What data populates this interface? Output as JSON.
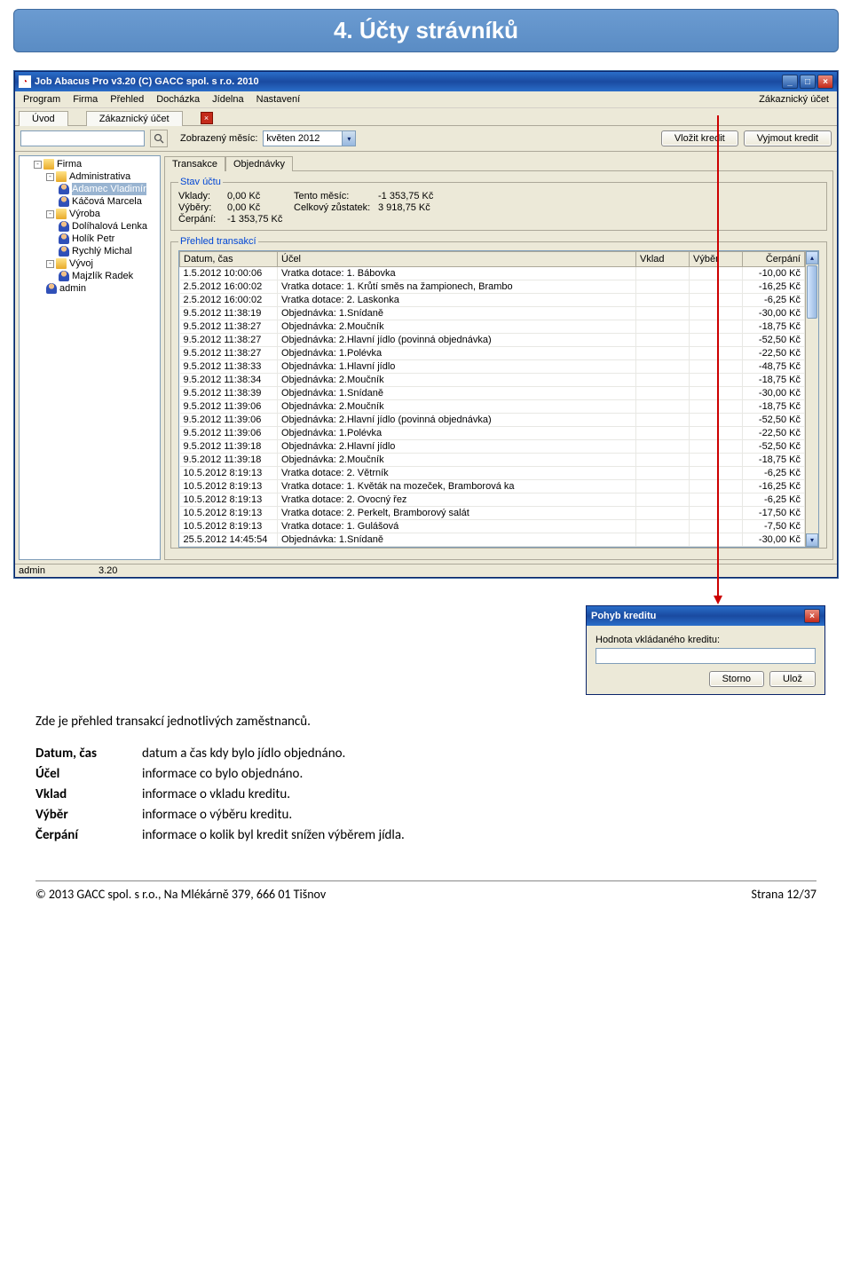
{
  "doc_title": "4. Účty strávníků",
  "window_title": "Job Abacus Pro v3.20 (C) GACC spol. s r.o. 2010",
  "menu": [
    "Program",
    "Firma",
    "Přehled",
    "Docházka",
    "Jídelna",
    "Nastavení"
  ],
  "menu_right": "Zákaznický účet",
  "tabs": {
    "intro": "Úvod",
    "account": "Zákaznický účet"
  },
  "toolbar": {
    "shown_month_label": "Zobrazený měsíc:",
    "shown_month_value": "květen 2012",
    "insert_credit": "Vložit kredit",
    "withdraw_credit": "Vyjmout kredit"
  },
  "tree": {
    "root": "Firma",
    "groups": [
      {
        "name": "Administrativa",
        "people": [
          "Adamec Vladimír",
          "Káčová Marcela"
        ]
      },
      {
        "name": "Výroba",
        "people": [
          "Dolíhalová Lenka",
          "Holík Petr",
          "Rychlý Michal"
        ]
      },
      {
        "name": "Vývoj",
        "people": [
          "Majzlík Radek"
        ]
      }
    ],
    "extra": "admin",
    "selected": "Adamec Vladimír"
  },
  "panel_tabs": {
    "trans": "Transakce",
    "orders": "Objednávky"
  },
  "account_state": {
    "legend": "Stav účtu",
    "rows": [
      [
        "Vklady:",
        "0,00 Kč",
        "Tento měsíc:",
        "-1 353,75 Kč"
      ],
      [
        "Výběry:",
        "0,00 Kč",
        "Celkový zůstatek:",
        "3 918,75 Kč"
      ],
      [
        "Čerpání:",
        "-1 353,75 Kč",
        "",
        ""
      ]
    ]
  },
  "trans_legend": "Přehled transakcí",
  "table": {
    "headers": [
      "Datum, čas",
      "Účel",
      "Vklad",
      "Výběr",
      "Čerpání"
    ],
    "rows": [
      [
        "1.5.2012 10:00:06",
        "Vratka dotace: 1. Bábovka",
        "",
        "",
        "-10,00 Kč"
      ],
      [
        "2.5.2012 16:00:02",
        "Vratka dotace: 1. Krůtí směs na žampionech, Brambo",
        "",
        "",
        "-16,25 Kč"
      ],
      [
        "2.5.2012 16:00:02",
        "Vratka dotace: 2. Laskonka",
        "",
        "",
        "-6,25 Kč"
      ],
      [
        "9.5.2012 11:38:19",
        "Objednávka: 1.Snídaně",
        "",
        "",
        "-30,00 Kč"
      ],
      [
        "9.5.2012 11:38:27",
        "Objednávka: 2.Moučník",
        "",
        "",
        "-18,75 Kč"
      ],
      [
        "9.5.2012 11:38:27",
        "Objednávka: 2.Hlavní jídlo (povinná objednávka)",
        "",
        "",
        "-52,50 Kč"
      ],
      [
        "9.5.2012 11:38:27",
        "Objednávka: 1.Polévka",
        "",
        "",
        "-22,50 Kč"
      ],
      [
        "9.5.2012 11:38:33",
        "Objednávka: 1.Hlavní jídlo",
        "",
        "",
        "-48,75 Kč"
      ],
      [
        "9.5.2012 11:38:34",
        "Objednávka: 2.Moučník",
        "",
        "",
        "-18,75 Kč"
      ],
      [
        "9.5.2012 11:38:39",
        "Objednávka: 1.Snídaně",
        "",
        "",
        "-30,00 Kč"
      ],
      [
        "9.5.2012 11:39:06",
        "Objednávka: 2.Moučník",
        "",
        "",
        "-18,75 Kč"
      ],
      [
        "9.5.2012 11:39:06",
        "Objednávka: 2.Hlavní jídlo (povinná objednávka)",
        "",
        "",
        "-52,50 Kč"
      ],
      [
        "9.5.2012 11:39:06",
        "Objednávka: 1.Polévka",
        "",
        "",
        "-22,50 Kč"
      ],
      [
        "9.5.2012 11:39:18",
        "Objednávka: 2.Hlavní jídlo",
        "",
        "",
        "-52,50 Kč"
      ],
      [
        "9.5.2012 11:39:18",
        "Objednávka: 2.Moučník",
        "",
        "",
        "-18,75 Kč"
      ],
      [
        "10.5.2012 8:19:13",
        "Vratka dotace: 2. Větrník",
        "",
        "",
        "-6,25 Kč"
      ],
      [
        "10.5.2012 8:19:13",
        "Vratka dotace: 1. Květák na mozeček, Bramborová ka",
        "",
        "",
        "-16,25 Kč"
      ],
      [
        "10.5.2012 8:19:13",
        "Vratka dotace: 2. Ovocný řez",
        "",
        "",
        "-6,25 Kč"
      ],
      [
        "10.5.2012 8:19:13",
        "Vratka dotace: 2. Perkelt, Bramborový salát",
        "",
        "",
        "-17,50 Kč"
      ],
      [
        "10.5.2012 8:19:13",
        "Vratka dotace: 1. Gulášová",
        "",
        "",
        "-7,50 Kč"
      ],
      [
        "25.5.2012 14:45:54",
        "Objednávka: 1.Snídaně",
        "",
        "",
        "-30,00 Kč"
      ]
    ]
  },
  "status": {
    "user": "admin",
    "version": "3.20"
  },
  "dialog": {
    "title": "Pohyb kreditu",
    "label": "Hodnota vkládaného kreditu:",
    "value": "",
    "cancel": "Storno",
    "save": "Ulož"
  },
  "body_text": {
    "intro": "Zde je přehled transakcí jednotlivých zaměstnanců.",
    "defs": [
      [
        "Datum, čas",
        "datum a čas kdy bylo jídlo objednáno."
      ],
      [
        "Účel",
        "informace co bylo objednáno."
      ],
      [
        "Vklad",
        "informace o vkladu kreditu."
      ],
      [
        "Výběr",
        "informace o výběru kreditu."
      ],
      [
        "Čerpání",
        "informace o kolik byl kredit snížen výběrem jídla."
      ]
    ]
  },
  "footer": {
    "left": "© 2013 GACC spol. s r.o., Na Mlékárně 379, 666 01 Tišnov",
    "right": "Strana 12/37"
  }
}
